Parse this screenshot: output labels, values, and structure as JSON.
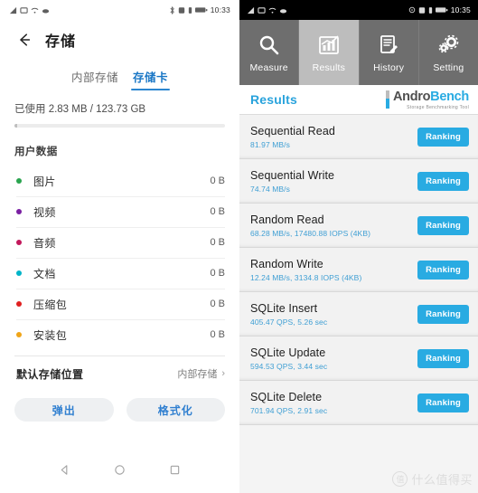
{
  "left": {
    "status": {
      "time": "10:33",
      "icons": [
        "signal-icon",
        "sim-icon",
        "wifi-icon",
        "cloud-icon"
      ],
      "right_icons": [
        "bluetooth-icon",
        "alarm-icon",
        "vibrate-icon",
        "battery-icon"
      ]
    },
    "appbar": {
      "back_icon": "back-arrow-icon",
      "title": "存储"
    },
    "tabs": [
      {
        "label": "内部存储",
        "active": false
      },
      {
        "label": "存储卡",
        "active": true
      }
    ],
    "usage": {
      "text": "已使用 2.83 MB / 123.73 GB",
      "used": "2.83 MB",
      "total": "123.73 GB",
      "percent": 1.5
    },
    "section_label": "用户数据",
    "categories": [
      {
        "name": "图片",
        "size": "0 B",
        "color": "#2aa44f"
      },
      {
        "name": "视频",
        "size": "0 B",
        "color": "#7a1fa2"
      },
      {
        "name": "音频",
        "size": "0 B",
        "color": "#c2185b"
      },
      {
        "name": "文档",
        "size": "0 B",
        "color": "#00b4c8"
      },
      {
        "name": "压缩包",
        "size": "0 B",
        "color": "#e02020"
      },
      {
        "name": "安装包",
        "size": "0 B",
        "color": "#f0a518"
      }
    ],
    "default_location": {
      "label": "默认存储位置",
      "value": "内部存储",
      "chevron": "›"
    },
    "buttons": [
      {
        "label": "弹出"
      },
      {
        "label": "格式化"
      }
    ],
    "navbar": [
      "back-triangle-icon",
      "home-circle-icon",
      "recents-square-icon"
    ]
  },
  "right": {
    "status": {
      "time": "10:35",
      "icons": [
        "signal-icon",
        "sim-icon",
        "wifi-icon",
        "cloud-icon"
      ],
      "right_icons": [
        "sync-icon",
        "alarm-icon",
        "vibrate-icon",
        "battery-icon"
      ]
    },
    "tabs": [
      {
        "label": "Measure",
        "icon": "magnifier-icon",
        "active": false
      },
      {
        "label": "Results",
        "icon": "bar-chart-icon",
        "active": true
      },
      {
        "label": "History",
        "icon": "document-edit-icon",
        "active": false
      },
      {
        "label": "Setting",
        "icon": "gears-icon",
        "active": false
      }
    ],
    "header": {
      "title": "Results",
      "brand_first": "Andro",
      "brand_second": "Bench",
      "brand_subtitle": "Storage Benchmarking Tool"
    },
    "results": [
      {
        "title": "Sequential Read",
        "value": "81.97 MB/s",
        "button": "Ranking"
      },
      {
        "title": "Sequential Write",
        "value": "74.74 MB/s",
        "button": "Ranking"
      },
      {
        "title": "Random Read",
        "value": "68.28 MB/s, 17480.88 IOPS (4KB)",
        "button": "Ranking"
      },
      {
        "title": "Random Write",
        "value": "12.24 MB/s, 3134.8 IOPS (4KB)",
        "button": "Ranking"
      },
      {
        "title": "SQLite Insert",
        "value": "405.47 QPS, 5.26 sec",
        "button": "Ranking"
      },
      {
        "title": "SQLite Update",
        "value": "594.53 QPS, 3.44 sec",
        "button": "Ranking"
      },
      {
        "title": "SQLite Delete",
        "value": "701.94 QPS, 2.91 sec",
        "button": "Ranking"
      }
    ],
    "watermark": {
      "logo": "值",
      "text": "什么值得买"
    }
  },
  "colors": {
    "accent_blue": "#29abe2",
    "tab_active_bg": "#bdbdbd",
    "tab_bg": "#6e6e6e",
    "link_blue": "#2b86d0"
  }
}
